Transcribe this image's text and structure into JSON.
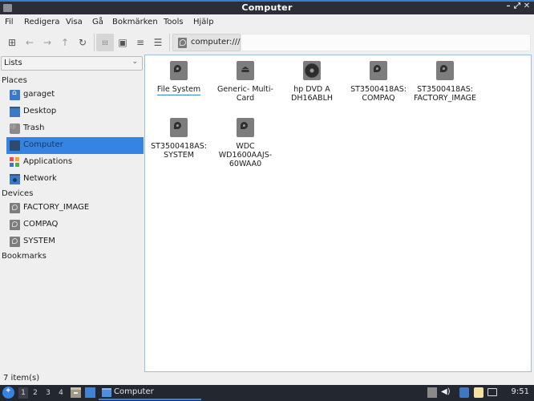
{
  "window": {
    "title": "Computer",
    "controls": {
      "minimize": "–",
      "maximize": "⤢",
      "close": "✕"
    }
  },
  "menubar": {
    "items": [
      "Fil",
      "Redigera",
      "Visa",
      "Gå",
      "Bokmärken",
      "Tools",
      "Hjälp"
    ]
  },
  "toolbar": {
    "buttons": [
      {
        "name": "new-tab",
        "icon": "new-tab-icon",
        "glyph": "⊞"
      },
      {
        "name": "back",
        "icon": "arrow-left-icon",
        "glyph": "←"
      },
      {
        "name": "forward",
        "icon": "arrow-right-icon",
        "glyph": "→"
      },
      {
        "name": "up",
        "icon": "arrow-up-icon",
        "glyph": "↑"
      },
      {
        "name": "reload",
        "icon": "reload-icon",
        "glyph": "↻"
      },
      {
        "name": "icon-view",
        "icon": "icon-view-icon",
        "glyph": "⁞⁞⁞"
      },
      {
        "name": "thumbnail-view",
        "icon": "thumbnail-view-icon",
        "glyph": "▣"
      },
      {
        "name": "compact-view",
        "icon": "compact-view-icon",
        "glyph": "≡"
      },
      {
        "name": "detailed-list-view",
        "icon": "detailed-list-icon",
        "glyph": "☰"
      }
    ],
    "path": "computer:///"
  },
  "sidebar": {
    "selector": {
      "value": "Lists",
      "chevron": "⌄"
    },
    "sections": {
      "places": "Places",
      "devices": "Devices",
      "bookmarks": "Bookmarks"
    },
    "places": [
      {
        "label": "garaget",
        "icon": "home-folder-icon"
      },
      {
        "label": "Desktop",
        "icon": "desktop-icon"
      },
      {
        "label": "Trash",
        "icon": "trash-icon"
      },
      {
        "label": "Computer",
        "icon": "computer-icon",
        "selected": true
      },
      {
        "label": "Applications",
        "icon": "applications-icon"
      },
      {
        "label": "Network",
        "icon": "network-icon"
      }
    ],
    "devices": [
      {
        "label": "FACTORY_IMAGE",
        "icon": "drive-icon"
      },
      {
        "label": "COMPAQ",
        "icon": "drive-icon"
      },
      {
        "label": "SYSTEM",
        "icon": "drive-icon"
      }
    ]
  },
  "content": {
    "items": [
      {
        "label": "File System",
        "icon": "harddisk-icon"
      },
      {
        "label": "Generic- Multi-Card",
        "icon": "removable-media-icon"
      },
      {
        "label": "hp DVD A DH16ABLH",
        "icon": "optical-drive-icon"
      },
      {
        "label": "ST3500418AS: COMPAQ",
        "icon": "harddisk-icon"
      },
      {
        "label": "ST3500418AS: FACTORY_IMAGE",
        "icon": "harddisk-icon"
      },
      {
        "label": "ST3500418AS: SYSTEM",
        "icon": "harddisk-icon"
      },
      {
        "label": "WDC WD1600AAJS-60WAA0",
        "icon": "harddisk-icon"
      }
    ]
  },
  "statusbar": {
    "text": "7 item(s)"
  },
  "taskbar": {
    "workspaces": [
      "1",
      "2",
      "3",
      "4"
    ],
    "current_workspace": "1",
    "task_label": "Computer",
    "clock": "9:51",
    "accent": "#3584e4"
  }
}
